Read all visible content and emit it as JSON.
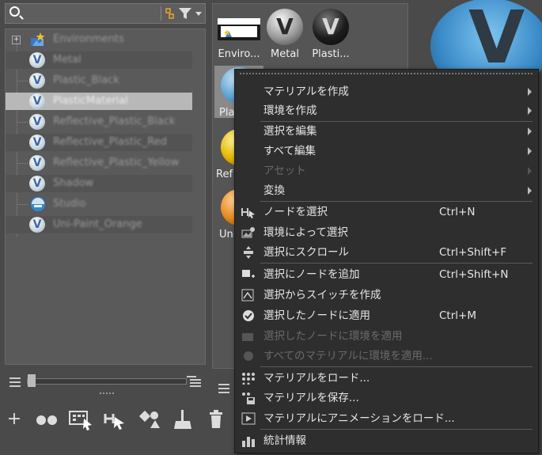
{
  "tree": {
    "items": [
      {
        "label": "Environments",
        "type": "env"
      },
      {
        "label": "Metal",
        "type": "mat"
      },
      {
        "label": "Plastic_Black",
        "type": "mat"
      },
      {
        "label": "PlasticMaterial",
        "type": "mat",
        "selected": true
      },
      {
        "label": "Reflective_Plastic_Black",
        "type": "mat"
      },
      {
        "label": "Reflective_Plastic_Red",
        "type": "mat"
      },
      {
        "label": "Reflective_Plastic_Yellow",
        "type": "mat"
      },
      {
        "label": "Shadow",
        "type": "mat"
      },
      {
        "label": "Studio",
        "type": "studio"
      },
      {
        "label": "Uni-Paint_Orange",
        "type": "mat"
      }
    ]
  },
  "thumbs": {
    "items": [
      {
        "label": "Enviro..."
      },
      {
        "label": "Metal"
      },
      {
        "label": "Plasti..."
      },
      {
        "label": "Pla"
      },
      {
        "label": "Ref"
      },
      {
        "label": "Uni"
      }
    ]
  },
  "colors": {
    "menu_bg": "#2e2e2e",
    "selected_row": "#b8b8b8",
    "accent_blue": "#3b8bc8"
  },
  "menu": {
    "items": [
      {
        "label": "マテリアルを作成",
        "submenu": true
      },
      {
        "label": "環境を作成",
        "submenu": true
      },
      {
        "label": "選択を編集",
        "submenu": true
      },
      {
        "label": "すべて編集",
        "submenu": true
      },
      {
        "label": "アセット",
        "submenu": true,
        "disabled": true
      },
      {
        "label": "変換",
        "submenu": true
      },
      {
        "label": "ノードを選択",
        "shortcut": "Ctrl+N",
        "icon": "select-node-icon"
      },
      {
        "label": "環境によって選択",
        "icon": "select-by-env-icon"
      },
      {
        "label": "選択にスクロール",
        "shortcut": "Ctrl+Shift+F",
        "icon": "scroll-icon"
      },
      {
        "label": "選択にノードを追加",
        "shortcut": "Ctrl+Shift+N",
        "icon": "add-node-icon"
      },
      {
        "label": "選択からスイッチを作成",
        "icon": "switch-icon"
      },
      {
        "label": "選択したノードに適用",
        "shortcut": "Ctrl+M",
        "icon": "apply-icon"
      },
      {
        "label": "選択したノードに環境を適用",
        "disabled": true,
        "icon": "apply-env-icon"
      },
      {
        "label": "すべてのマテリアルに環境を適用...",
        "disabled": true,
        "icon": "apply-all-env-icon"
      },
      {
        "label": "マテリアルをロード...",
        "icon": "load-icon"
      },
      {
        "label": "マテリアルを保存...",
        "icon": "save-icon"
      },
      {
        "label": "マテリアルにアニメーションをロード...",
        "icon": "animation-icon"
      },
      {
        "label": "統計情報",
        "icon": "stats-icon"
      }
    ]
  }
}
